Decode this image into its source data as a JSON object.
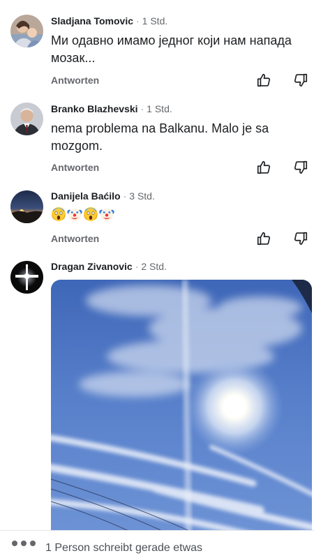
{
  "comments": [
    {
      "author": "Sladjana Tomovic",
      "separator": "·",
      "time": "1 Std.",
      "text": "Ми одавно имамо једног који нам напада мозак...",
      "reply_label": "Antworten",
      "avatar_icon": "family-photo-avatar"
    },
    {
      "author": "Branko Blazhevski",
      "separator": "·",
      "time": "1 Std.",
      "text": "nema problema na Balkanu. Malo je sa mozgom.",
      "reply_label": "Antworten",
      "avatar_icon": "man-in-suit-avatar"
    },
    {
      "author": "Danijela Baćilo",
      "separator": "·",
      "time": "3 Std.",
      "emojis": [
        "face-screaming-emoji",
        "clown-face-emoji",
        "face-screaming-emoji",
        "clown-face-emoji"
      ],
      "reply_label": "Antworten",
      "avatar_icon": "sunset-landscape-avatar"
    },
    {
      "author": "Dragan Zivanovic",
      "separator": "·",
      "time": "2 Std.",
      "attachment": "sky-with-contrails-photo",
      "avatar_icon": "glowing-cross-avatar"
    }
  ],
  "icons": {
    "like": "thumbs-up-icon",
    "dislike": "thumbs-down-icon",
    "typing": "typing-dots-icon"
  },
  "typing_indicator": {
    "text": "1 Person schreibt gerade etwas"
  },
  "colors": {
    "text": "#1c1e21",
    "secondary": "#65676b",
    "sky": "#5a82cc"
  }
}
